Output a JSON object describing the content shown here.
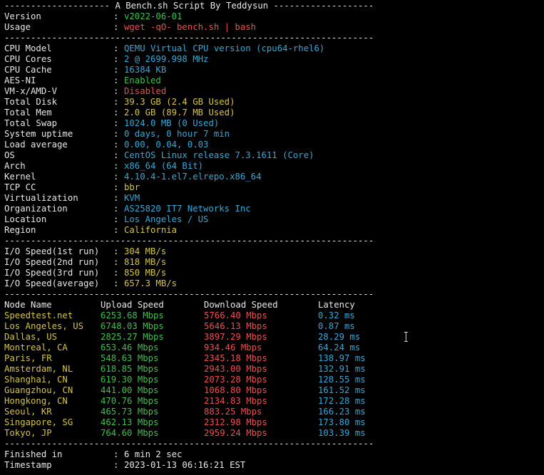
{
  "header": {
    "title_line": "-------------------- A Bench.sh Script By Teddysun -------------------"
  },
  "script_info": [
    {
      "label": "Version",
      "value": "v2022-06-01",
      "color": "green"
    },
    {
      "label": "Usage",
      "value": "wget -qO- bench.sh | bash",
      "color": "red"
    }
  ],
  "separator": "----------------------------------------------------------------------",
  "system_info": [
    {
      "label": "CPU Model",
      "value": "QEMU Virtual CPU version (cpu64-rhel6)",
      "color": "cyan"
    },
    {
      "label": "CPU Cores",
      "value": "2 @ 2699.998 MHz",
      "color": "cyan"
    },
    {
      "label": "CPU Cache",
      "value": "16384 KB",
      "color": "cyan"
    },
    {
      "label": "AES-NI",
      "value": "Enabled",
      "color": "green"
    },
    {
      "label": "VM-x/AMD-V",
      "value": "Disabled",
      "color": "red"
    },
    {
      "label": "Total Disk",
      "value": "39.3 GB (2.4 GB Used)",
      "color": "yellow"
    },
    {
      "label": "Total Mem",
      "value": "2.0 GB (89.7 MB Used)",
      "color": "yellow"
    },
    {
      "label": "Total Swap",
      "value": "1024.0 MB (0 Used)",
      "color": "cyan"
    },
    {
      "label": "System uptime",
      "value": "0 days, 0 hour 7 min",
      "color": "cyan"
    },
    {
      "label": "Load average",
      "value": "0.00, 0.04, 0.03",
      "color": "cyan"
    },
    {
      "label": "OS",
      "value": "CentOS Linux release 7.3.1611 (Core)",
      "color": "cyan"
    },
    {
      "label": "Arch",
      "value": "x86_64 (64 Bit)",
      "color": "cyan"
    },
    {
      "label": "Kernel",
      "value": "4.10.4-1.el7.elrepo.x86_64",
      "color": "cyan"
    },
    {
      "label": "TCP CC",
      "value": "bbr",
      "color": "yellow"
    },
    {
      "label": "Virtualization",
      "value": "KVM",
      "color": "cyan"
    },
    {
      "label": "Organization",
      "value": "AS25820 IT7 Networks Inc",
      "color": "cyan"
    },
    {
      "label": "Location",
      "value": "Los Angeles / US",
      "color": "cyan"
    },
    {
      "label": "Region",
      "value": "California",
      "color": "yellow"
    }
  ],
  "io_info": [
    {
      "label": "I/O Speed(1st run)",
      "value": "304 MB/s",
      "color": "yellow"
    },
    {
      "label": "I/O Speed(2nd run)",
      "value": "818 MB/s",
      "color": "yellow"
    },
    {
      "label": "I/O Speed(3rd run)",
      "value": "850 MB/s",
      "color": "yellow"
    },
    {
      "label": "I/O Speed(average)",
      "value": "657.3 MB/s",
      "color": "yellow"
    }
  ],
  "speed_table": {
    "headers": [
      "Node Name",
      "Upload Speed",
      "Download Speed",
      "Latency"
    ],
    "rows": [
      [
        "Speedtest.net",
        "6253.68 Mbps",
        "5766.40 Mbps",
        "0.32 ms"
      ],
      [
        "Los Angeles, US",
        "6748.03 Mbps",
        "5646.13 Mbps",
        "0.87 ms"
      ],
      [
        "Dallas, US",
        "2825.27 Mbps",
        "3897.29 Mbps",
        "28.29 ms"
      ],
      [
        "Montreal, CA",
        "653.46 Mbps",
        "934.46 Mbps",
        "64.24 ms"
      ],
      [
        "Paris, FR",
        "548.63 Mbps",
        "2345.18 Mbps",
        "138.97 ms"
      ],
      [
        "Amsterdam, NL",
        "618.85 Mbps",
        "2943.00 Mbps",
        "132.91 ms"
      ],
      [
        "Shanghai, CN",
        "619.30 Mbps",
        "2073.28 Mbps",
        "128.55 ms"
      ],
      [
        "Guangzhou, CN",
        "441.00 Mbps",
        "1068.80 Mbps",
        "161.52 ms"
      ],
      [
        "Hongkong, CN",
        "470.76 Mbps",
        "2134.83 Mbps",
        "172.28 ms"
      ],
      [
        "Seoul, KR",
        "465.73 Mbps",
        "883.25 Mbps",
        "166.23 ms"
      ],
      [
        "Singapore, SG",
        "462.13 Mbps",
        "2312.98 Mbps",
        "173.80 ms"
      ],
      [
        "Tokyo, JP",
        "764.60 Mbps",
        "2959.24 Mbps",
        "103.39 ms"
      ]
    ]
  },
  "footer": [
    {
      "label": "Finished in",
      "value": "6 min 2 sec"
    },
    {
      "label": "Timestamp",
      "value": "2023-01-13 06:16:21 EST"
    }
  ],
  "colors": {
    "background": "#000000",
    "text": "#e8e8e8",
    "green": "#3dc04a",
    "red": "#ef4d4d",
    "yellow": "#d6c34a",
    "cyan": "#37a8d4"
  },
  "icons": {
    "cursor": "i-beam-cursor-icon"
  }
}
